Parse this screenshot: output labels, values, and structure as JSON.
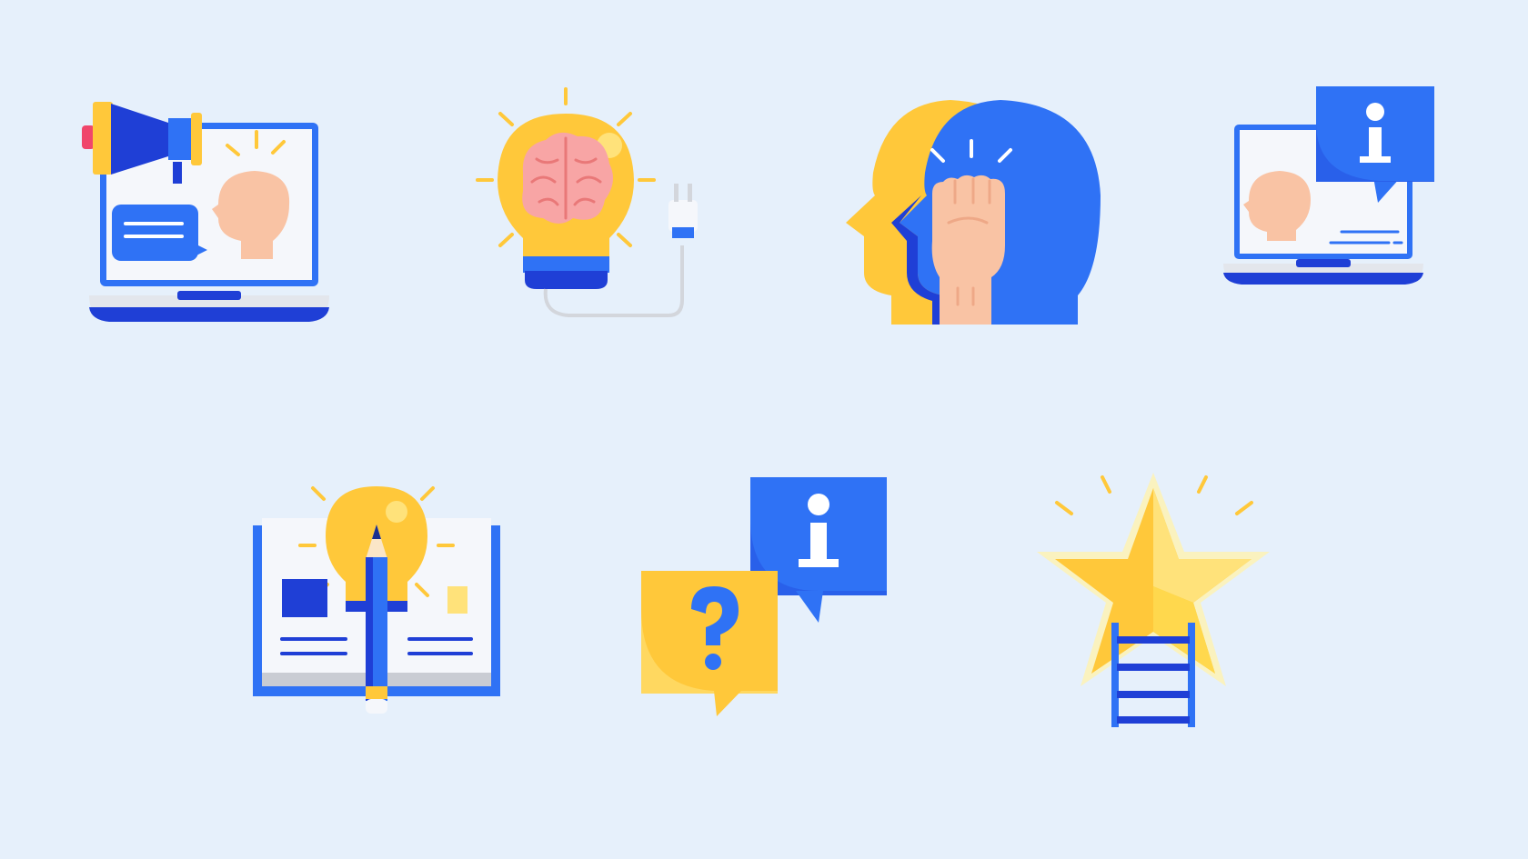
{
  "icons": [
    {
      "name": "laptop-megaphone-icon"
    },
    {
      "name": "lightbulb-brain-icon"
    },
    {
      "name": "head-fist-icon"
    },
    {
      "name": "laptop-info-icon"
    },
    {
      "name": "book-idea-icon"
    },
    {
      "name": "question-info-chat-icon"
    },
    {
      "name": "star-ladder-icon"
    }
  ],
  "colors": {
    "background": "#e6f0fb",
    "blue": "#2f72f5",
    "dark_blue": "#1f3fd6",
    "yellow": "#ffc83a",
    "light_yellow": "#ffe27a",
    "skin": "#f9c3a4",
    "pink": "#f38b8b",
    "white": "#f5f7fb",
    "gray": "#d3d6dc"
  }
}
